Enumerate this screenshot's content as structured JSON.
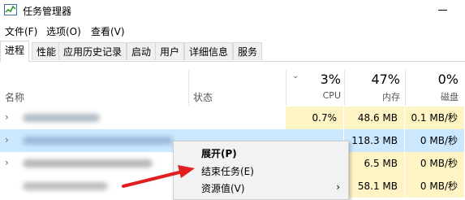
{
  "window": {
    "title": "任务管理器"
  },
  "menu": [
    "文件(F)",
    "选项(O)",
    "查看(V)"
  ],
  "tabs": [
    "进程",
    "性能",
    "应用历史记录",
    "启动",
    "用户",
    "详细信息",
    "服务"
  ],
  "columns": {
    "name": "名称",
    "status": "状态",
    "cpu": {
      "percent": "3%",
      "label": "CPU"
    },
    "memory": {
      "percent": "47%",
      "label": "内存"
    },
    "disk": {
      "percent": "0%",
      "label": "磁盘"
    }
  },
  "rows": [
    {
      "cpu": "0.7%",
      "memory": "48.6 MB",
      "disk": "0.1 MB/秒"
    },
    {
      "cpu": "",
      "memory": "118.3 MB",
      "disk": "0 MB/秒"
    },
    {
      "cpu": "",
      "memory": "6.5 MB",
      "disk": "0 MB/秒"
    },
    {
      "cpu": "",
      "memory": "58.1 MB",
      "disk": "0 MB/秒"
    }
  ],
  "context_menu": {
    "expand": "展开(P)",
    "end_task": "结束任务(E)",
    "resource_values": "资源值(V)"
  },
  "colors": {
    "highlight": "#fff4c4",
    "selected": "#cce8ff",
    "arrow": "#e02020"
  }
}
